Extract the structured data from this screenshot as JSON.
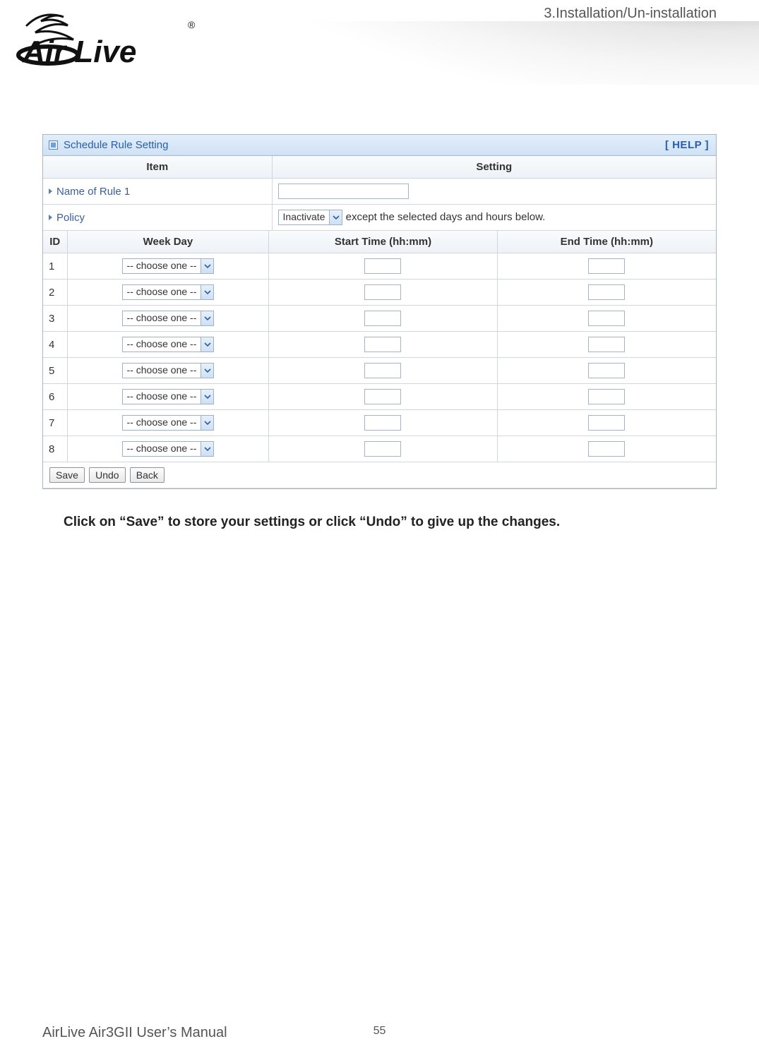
{
  "header": {
    "chapter": "3.Installation/Un-installation",
    "logo_text": "Air Live",
    "logo_mark": "®"
  },
  "panel": {
    "title": "Schedule Rule Setting",
    "help": "[ HELP ]",
    "cols": {
      "item": "Item",
      "setting": "Setting"
    },
    "name_row": {
      "label": "Name of Rule 1",
      "value": ""
    },
    "policy_row": {
      "label": "Policy",
      "select_value": "Inactivate",
      "suffix": "except the selected days and hours below."
    },
    "sched_headers": {
      "id": "ID",
      "weekday": "Week Day",
      "start": "Start Time (hh:mm)",
      "end": "End Time (hh:mm)"
    },
    "choose_label": "-- choose one --",
    "rows": [
      "1",
      "2",
      "3",
      "4",
      "5",
      "6",
      "7",
      "8"
    ],
    "buttons": {
      "save": "Save",
      "undo": "Undo",
      "back": "Back"
    }
  },
  "caption": "Click on “Save” to store your settings or click “Undo” to give up the changes.",
  "footer": {
    "manual": "AirLive Air3GII User’s Manual",
    "page": "55"
  }
}
